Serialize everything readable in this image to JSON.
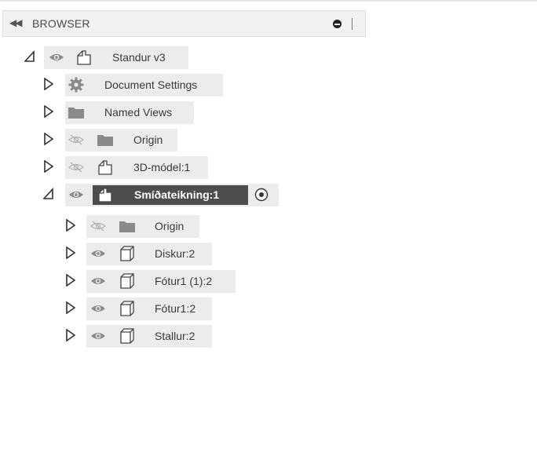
{
  "panel": {
    "title": "BROWSER",
    "collapse_icon": "double-chevron-left-icon",
    "pin_icon": "pin-icon"
  },
  "tree": {
    "root": "Standur v3",
    "document_settings": "Document Settings",
    "named_views": "Named Views",
    "origin": "Origin",
    "model3d": "3D-módel:1",
    "drawing": "Smíðateikning:1",
    "drawing_origin": "Origin",
    "disk": "Diskur:2",
    "foot_copy": "Fótur1 (1):2",
    "foot": "Fótur1:2",
    "stand": "Stallur:2"
  },
  "colors": {
    "selected_bg": "#4d4d4d",
    "row_bg": "#ececec",
    "icon_gray": "#8a8a8a"
  }
}
